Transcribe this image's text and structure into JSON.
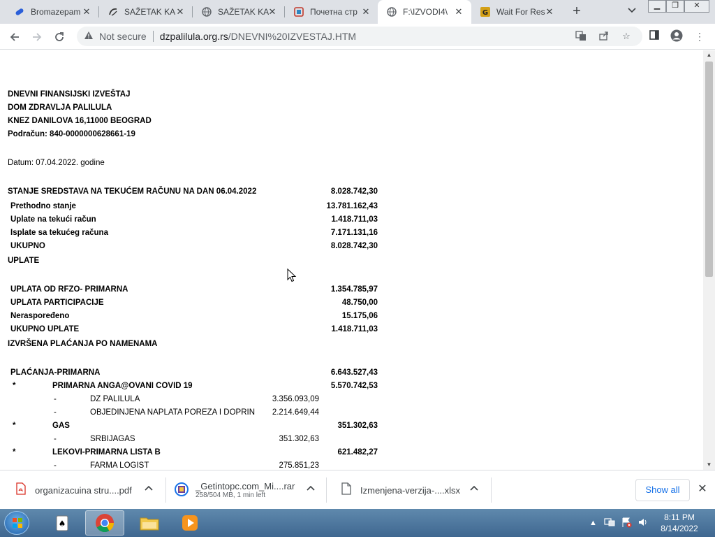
{
  "browser": {
    "tabs": [
      {
        "label": "Bromazepam",
        "icon": "pill-icon"
      },
      {
        "label": "SAŽETAK KA",
        "icon": "alims-icon"
      },
      {
        "label": "SAŽETAK KA",
        "icon": "globe-icon"
      },
      {
        "label": "Почетна стр",
        "icon": "site-icon"
      },
      {
        "label": "F:\\IZVODI4\\",
        "icon": "globe-icon"
      },
      {
        "label": "Wait For Res",
        "icon": "getintopc-icon"
      }
    ],
    "active_tab_index": 4,
    "address": {
      "security": "Not secure",
      "host": "dzpalilula.org.rs",
      "path": "/DNEVNI%20IZVESTAJ.HTM"
    }
  },
  "report": {
    "header": [
      "DNEVNI FINANSIJSKI IZVEŠTAJ",
      "DOM ZDRAVLJA PALILULA",
      "KNEZ DANILOVA 16,11000 BEOGRAD",
      "Podračun: 840-0000000628661-19"
    ],
    "date": "Datum: 07.04.2022. godine",
    "balance": {
      "title": "STANJE SREDSTAVA NA TEKUĆEM RAČUNU NA DAN 06.04.2022",
      "title_value": "8.028.742,30",
      "rows": [
        {
          "label": "Prethodno stanje",
          "value": "13.781.162,43"
        },
        {
          "label": "Uplate na tekući račun",
          "value": "1.418.711,03"
        },
        {
          "label": "Isplate sa tekućeg računa",
          "value": "7.171.131,16"
        },
        {
          "label": "UKUPNO",
          "value": "8.028.742,30"
        }
      ]
    },
    "uplate": {
      "title": "UPLATE",
      "rows": [
        {
          "label": "UPLATA OD RFZO- PRIMARNA",
          "value": "1.354.785,97"
        },
        {
          "label": "UPLATA PARTICIPACIJE",
          "value": "48.750,00"
        },
        {
          "label": "Neraspoređeno",
          "value": "15.175,06"
        },
        {
          "label": "UKUPNO UPLATE",
          "value": "1.418.711,03"
        }
      ]
    },
    "placanja": {
      "title": "IZVRŠENA PLAĆANJA PO NAMENAMA",
      "group_label": "PLAĆANJA-PRIMARNA",
      "group_value": "6.643.527,43",
      "star": "*",
      "dash": "-",
      "items": [
        {
          "kind": "cat",
          "label": "PRIMARNA ANGA@OVANI COVID 19",
          "value": "5.570.742,53"
        },
        {
          "kind": "sub",
          "label": "DZ PALILULA",
          "value": "3.356.093,09"
        },
        {
          "kind": "sub",
          "label": "OBJEDINJENA NAPLATA POREZA I DOPRIN",
          "value": "2.214.649,44"
        },
        {
          "kind": "cat",
          "label": "GAS",
          "value": "351.302,63"
        },
        {
          "kind": "sub",
          "label": "SRBIJAGAS",
          "value": "351.302,63"
        },
        {
          "kind": "cat",
          "label": "LEKOVI-PRIMARNA LISTA B",
          "value": "621.482,27"
        },
        {
          "kind": "sub",
          "label": "FARMA LOGIST",
          "value": "275.851,23"
        }
      ]
    }
  },
  "downloads": {
    "items": [
      {
        "name": "organizacuina stru....pdf",
        "sub": "",
        "icon": "pdf-icon"
      },
      {
        "name": "_Getintopc.com_Mi....rar",
        "sub": "258/504 MB, 1 min left",
        "icon": "rar-icon"
      },
      {
        "name": "Izmenjena-verzija-....xlsx",
        "sub": "",
        "icon": "file-icon"
      }
    ],
    "show_all": "Show all"
  },
  "taskbar": {
    "time": "8:11 PM",
    "date": "8/14/2022"
  }
}
